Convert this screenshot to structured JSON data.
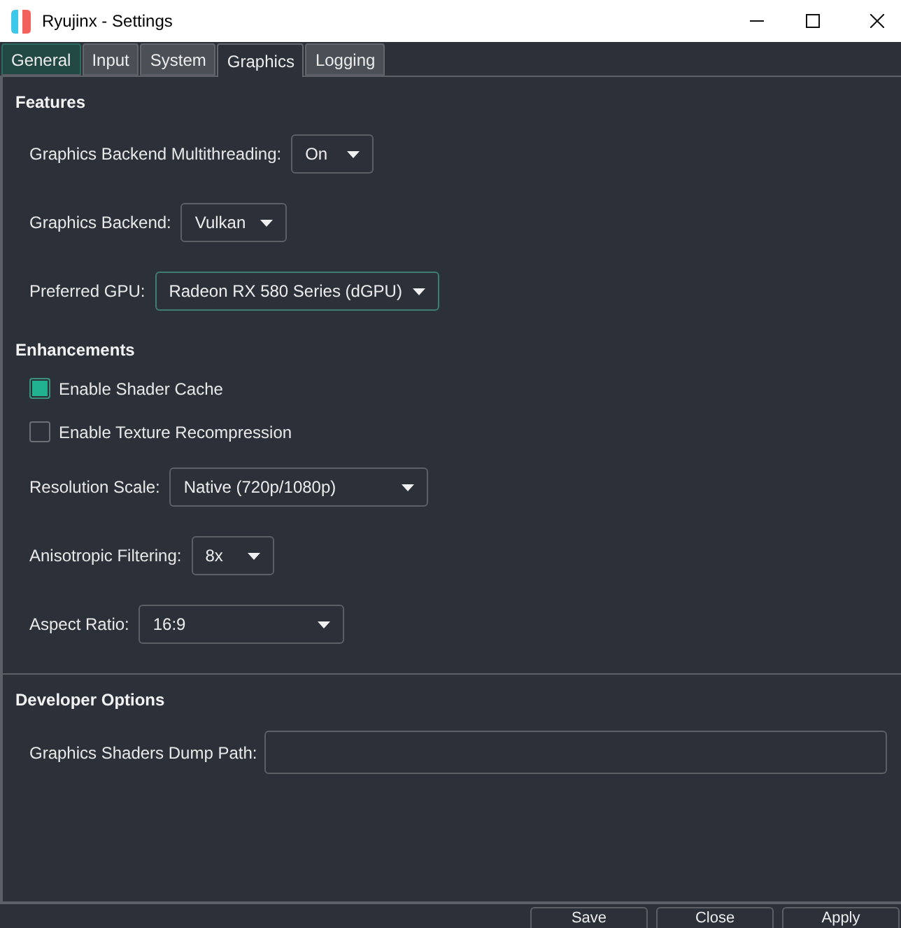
{
  "window": {
    "title": "Ryujinx - Settings"
  },
  "tabs": [
    {
      "label": "General",
      "selected": false,
      "highlighted": true
    },
    {
      "label": "Input",
      "selected": false,
      "highlighted": false
    },
    {
      "label": "System",
      "selected": false,
      "highlighted": false
    },
    {
      "label": "Graphics",
      "selected": true,
      "highlighted": false
    },
    {
      "label": "Logging",
      "selected": false,
      "highlighted": false
    }
  ],
  "sections": [
    {
      "title": "Features",
      "items": [
        {
          "kind": "dropdown",
          "label": "Graphics Backend Multithreading:",
          "value": "On",
          "focused": false
        },
        {
          "kind": "dropdown",
          "label": "Graphics Backend:",
          "value": "Vulkan",
          "focused": false
        },
        {
          "kind": "dropdown",
          "label": "Preferred GPU:",
          "value": "Radeon RX 580 Series (dGPU)",
          "focused": true
        }
      ]
    },
    {
      "title": "Enhancements",
      "items": [
        {
          "kind": "checkbox",
          "label": "Enable Shader Cache",
          "checked": true
        },
        {
          "kind": "checkbox",
          "label": "Enable Texture Recompression",
          "checked": false
        },
        {
          "kind": "dropdown",
          "label": "Resolution Scale:",
          "value": "Native (720p/1080p)",
          "focused": false
        },
        {
          "kind": "dropdown",
          "label": "Anisotropic Filtering:",
          "value": "8x",
          "focused": false
        },
        {
          "kind": "dropdown",
          "label": "Aspect Ratio:",
          "value": "16:9",
          "focused": false
        }
      ]
    },
    {
      "title": "Developer Options",
      "items": [
        {
          "kind": "text-field",
          "label": "Graphics Shaders Dump Path:"
        }
      ]
    }
  ],
  "buttons": [
    {
      "label": "Save"
    },
    {
      "label": "Close"
    },
    {
      "label": "Apply"
    }
  ]
}
